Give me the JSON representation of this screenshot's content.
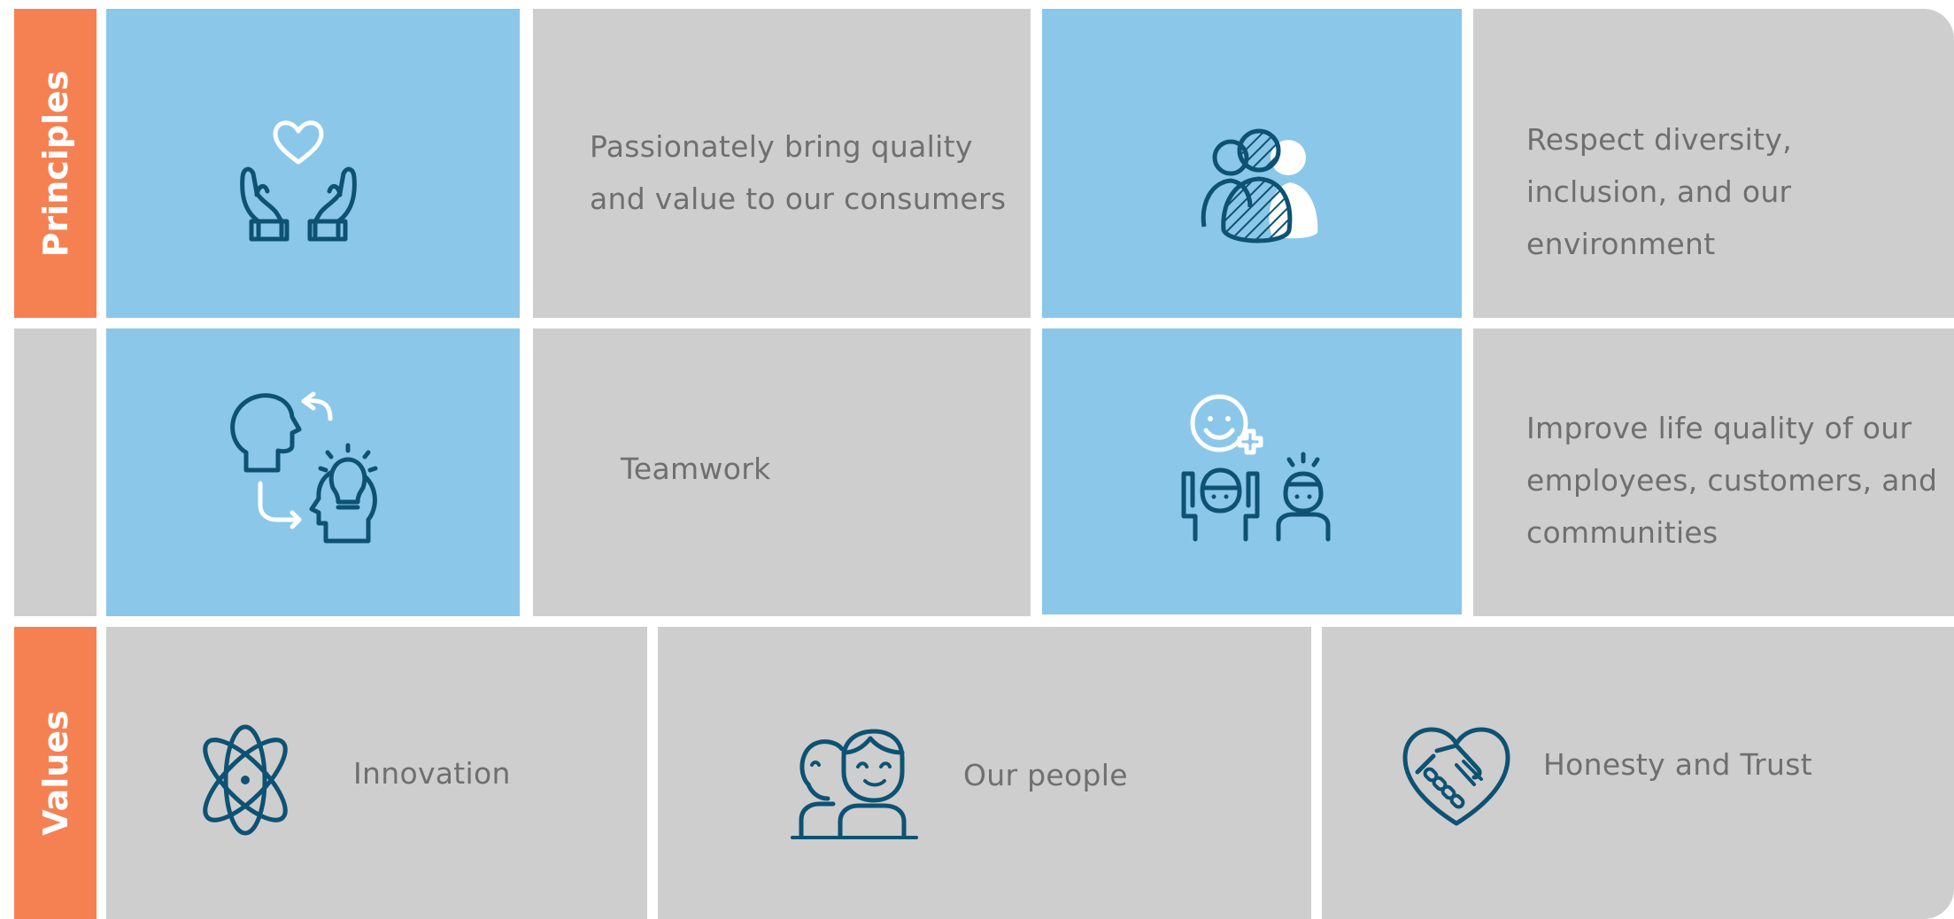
{
  "sidebar": {
    "principles_label": "Principles",
    "values_label": "Values"
  },
  "principles": [
    {
      "icon": "hands-heart-icon",
      "text_lines": [
        "Passionately bring quality",
        "and value to our consumers"
      ]
    },
    {
      "icon": "diverse-people-icon",
      "text_lines": [
        "Respect diversity,",
        "inclusion, and our",
        "environment"
      ]
    },
    {
      "icon": "teamwork-ideas-icon",
      "text_lines": [
        "Teamwork"
      ]
    },
    {
      "icon": "happy-people-icon",
      "text_lines": [
        "Improve life quality of our",
        "employees, customers, and",
        "communities"
      ]
    }
  ],
  "values": [
    {
      "icon": "atom-icon",
      "label": "Innovation"
    },
    {
      "icon": "people-icon",
      "label": "Our people"
    },
    {
      "icon": "handshake-heart-icon",
      "label": "Honesty and Trust"
    }
  ],
  "colors": {
    "accent_orange": "#f58153",
    "tile_blue": "#8bc7e9",
    "tile_gray": "#cecece",
    "icon_dark": "#0e5273",
    "text_gray": "#6f6f6f"
  }
}
